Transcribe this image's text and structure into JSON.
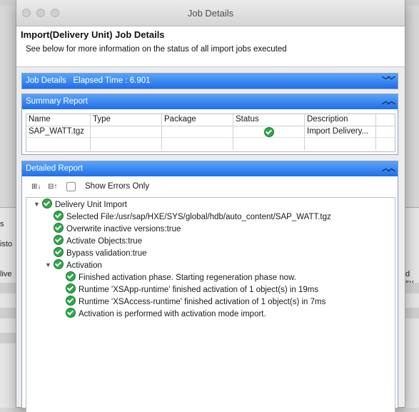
{
  "window": {
    "title": "Job Details"
  },
  "header": {
    "title": "Import(Delivery Unit) Job Details",
    "subtitle": "See below for more information on the status of all import jobs executed"
  },
  "job_details": {
    "label": "Job Details",
    "elapsed": "Elapsed Time : 6.901"
  },
  "summary": {
    "label": "Summary Report",
    "columns": [
      "Name",
      "Type",
      "Package",
      "Status",
      "Description"
    ],
    "rows": [
      {
        "name": "SAP_WATT.tgz",
        "type": "",
        "package": "",
        "status": "success",
        "description": "Import Delivery..."
      }
    ]
  },
  "detailed": {
    "label": "Detailed Report",
    "show_errors_label": "Show Errors Only",
    "tree": [
      {
        "text": "Delivery Unit Import"
      },
      {
        "text": "Selected File:/usr/sap/HXE/SYS/global/hdb/auto_content/SAP_WATT.tgz"
      },
      {
        "text": "Overwrite inactive versions:true"
      },
      {
        "text": "Activate Objects:true"
      },
      {
        "text": "Bypass validation:true"
      },
      {
        "text": "Activation"
      },
      {
        "text": "Finished activation phase. Starting regeneration phase now."
      },
      {
        "text": "Runtime 'XSApp-runtime' finished activation of 1 object(s) in 19ms"
      },
      {
        "text": "Runtime 'XSAccess-runtime' finished activation of 1 object(s) in 7ms"
      },
      {
        "text": "Activation is performed with activation mode import."
      }
    ]
  },
  "background": {
    "left_fragments": [
      "s",
      "isto",
      "live"
    ],
    "right_fragments": [
      "d su"
    ]
  }
}
